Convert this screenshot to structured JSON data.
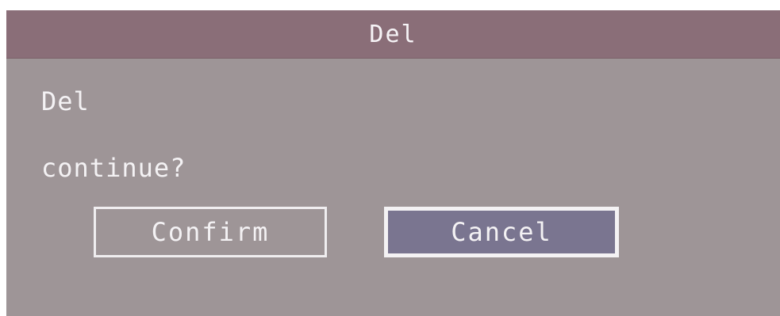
{
  "dialog": {
    "title": "Del",
    "message_line1": "Del",
    "message_line2": "continue?",
    "confirm_label": "Confirm",
    "cancel_label": "Cancel",
    "selected_button": "Cancel"
  },
  "colors": {
    "title_bar": "#8a6e78",
    "body": "#9e9597",
    "text": "#f4f2f4",
    "focused_button_fill": "#7a7590"
  }
}
